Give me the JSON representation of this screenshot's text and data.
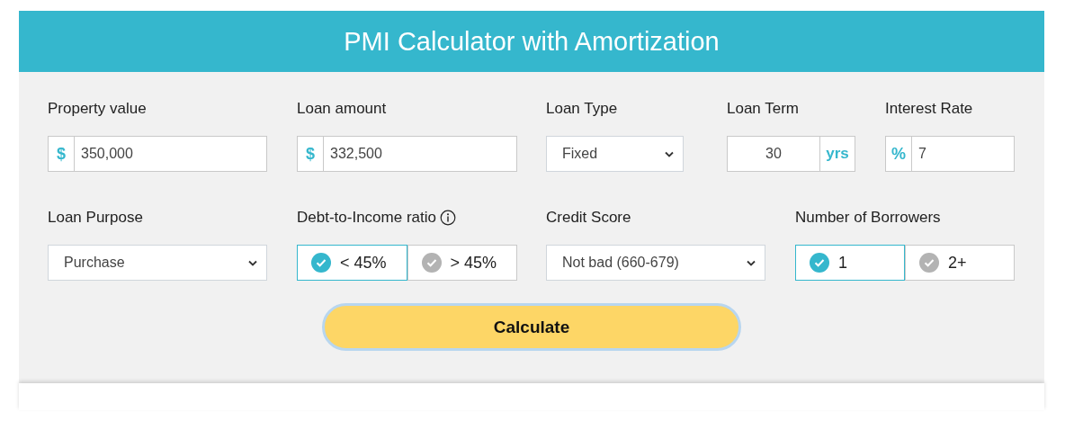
{
  "header": {
    "title": "PMI Calculator with Amortization"
  },
  "rows": [
    [
      {
        "kind": "prefixed",
        "label": "Property value",
        "prefix": "$",
        "value": "350,000"
      },
      {
        "kind": "prefixed",
        "label": "Loan amount",
        "prefix": "$",
        "value": "332,500"
      },
      {
        "kind": "select",
        "label": "Loan Type",
        "value": "Fixed"
      },
      {
        "kind": "suffixed",
        "label": "Loan Term",
        "value": "30",
        "suffix": "yrs"
      },
      {
        "kind": "prefixed",
        "label": "Interest Rate",
        "prefix": "%",
        "value": "7"
      }
    ],
    [
      {
        "kind": "select",
        "label": "Loan Purpose",
        "value": "Purchase"
      },
      {
        "kind": "toggle",
        "label": "Debt-to-Income ratio",
        "info": true,
        "options": [
          {
            "label": "< 45%",
            "selected": true
          },
          {
            "label": "> 45%",
            "selected": false
          }
        ]
      },
      {
        "kind": "select",
        "label": "Credit Score",
        "value": "Not bad (660-679)"
      },
      {
        "kind": "toggle",
        "label": "Number of Borrowers",
        "info": false,
        "options": [
          {
            "label": "1",
            "selected": true
          },
          {
            "label": "2+",
            "selected": false
          }
        ]
      }
    ]
  ],
  "button": "Calculate"
}
